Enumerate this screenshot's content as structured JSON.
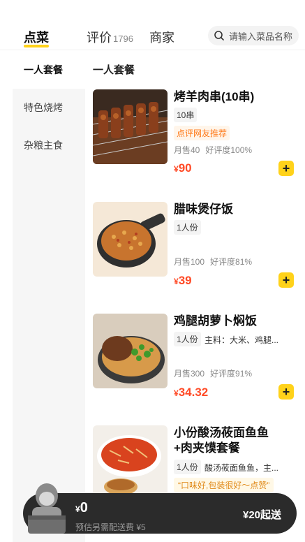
{
  "header": {
    "tabs": [
      {
        "label": "点菜",
        "count": ""
      },
      {
        "label": "评价",
        "count": "1796"
      },
      {
        "label": "商家",
        "count": ""
      }
    ],
    "search_placeholder": "请输入菜品名称"
  },
  "sidebar": {
    "items": [
      {
        "label": "一人套餐"
      },
      {
        "label": "特色烧烤"
      },
      {
        "label": "杂粮主食"
      }
    ]
  },
  "section_title": "一人套餐",
  "dishes": [
    {
      "name": "烤羊肉串(10串)",
      "tag": "10串",
      "promo": "点评网友推荐",
      "sales": "月售40",
      "rating": "好评度100%",
      "currency": "¥",
      "price": "90",
      "image_icon": "lamb-skewers-image"
    },
    {
      "name": "腊味煲仔饭",
      "tag": "1人份",
      "sales": "月售100",
      "rating": "好评度81%",
      "currency": "¥",
      "price": "39",
      "image_icon": "claypot-rice-image"
    },
    {
      "name": "鸡腿胡萝卜焖饭",
      "tag": "1人份",
      "desc": "主料：大米、鸡腿...",
      "sales": "月售300",
      "rating": "好评度91%",
      "currency": "¥",
      "price": "34.32",
      "image_icon": "chicken-rice-image"
    },
    {
      "name_line1": "小份酸汤莜面鱼鱼",
      "name_line2": "+肉夹馍套餐",
      "tag": "1人份",
      "desc": "酸汤莜面鱼鱼，主...",
      "quote": "“口味好,包装很好～点赞”",
      "image_icon": "sour-soup-noodles-image"
    }
  ],
  "add_label": "+",
  "cart": {
    "currency": "¥",
    "total": "0",
    "note": "预估另需配送费 ¥5",
    "min_order": "¥20起送"
  },
  "colors": {
    "accent": "#ffd21a",
    "price": "#ff4a26",
    "cart_bg": "#2b2b2b"
  }
}
